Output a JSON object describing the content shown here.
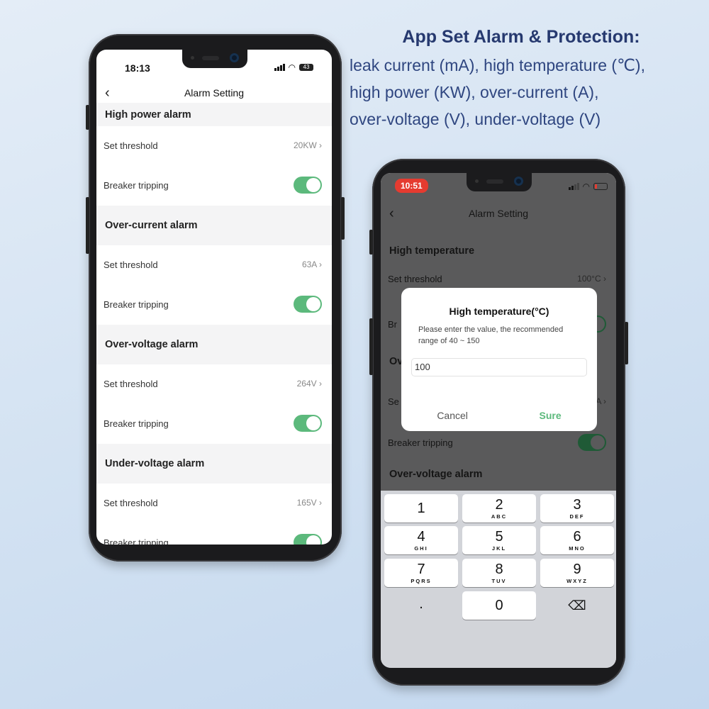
{
  "headline": {
    "title": "App Set Alarm & Protection:",
    "lines": [
      "leak current (mA), high temperature (℃),",
      "high power (KW), over-current (A),",
      "over-voltage (V), under-voltage (V)"
    ]
  },
  "phone1": {
    "time": "18:13",
    "battery": "43",
    "nav_title": "Alarm Setting",
    "sections": [
      {
        "title": "High power alarm",
        "threshold_label": "Set threshold",
        "threshold": "20KW",
        "trip_label": "Breaker tripping",
        "trip_on": true
      },
      {
        "title": "Over-current alarm",
        "threshold_label": "Set threshold",
        "threshold": "63A",
        "trip_label": "Breaker tripping",
        "trip_on": true
      },
      {
        "title": "Over-voltage alarm",
        "threshold_label": "Set threshold",
        "threshold": "264V",
        "trip_label": "Breaker tripping",
        "trip_on": true
      },
      {
        "title": "Under-voltage alarm",
        "threshold_label": "Set threshold",
        "threshold": "165V",
        "trip_label": "Breaker tripping",
        "trip_on": true
      }
    ]
  },
  "phone2": {
    "time": "10:51",
    "nav_title": "Alarm Setting",
    "bg": {
      "sec1": "High temperature",
      "set": "Set threshold",
      "val": "100°C",
      "trip": "Breaker tripping",
      "sec2": "Ov",
      "set2": "Se",
      "val2": "A",
      "trip2": "Breaker tripping",
      "sec3": "Over-voltage alarm"
    },
    "dialog": {
      "title": "High temperature(°C)",
      "message": "Please enter the value, the recommended range of 40 ~ 150",
      "value": "100",
      "cancel": "Cancel",
      "confirm": "Sure"
    },
    "keyboard": [
      {
        "d": "1",
        "l": ""
      },
      {
        "d": "2",
        "l": "ABC"
      },
      {
        "d": "3",
        "l": "DEF"
      },
      {
        "d": "4",
        "l": "GHI"
      },
      {
        "d": "5",
        "l": "JKL"
      },
      {
        "d": "6",
        "l": "MNO"
      },
      {
        "d": "7",
        "l": "PQRS"
      },
      {
        "d": "8",
        "l": "TUV"
      },
      {
        "d": "9",
        "l": "WXYZ"
      },
      {
        "d": ".",
        "l": ""
      },
      {
        "d": "0",
        "l": ""
      },
      {
        "d": "⌫",
        "l": ""
      }
    ]
  },
  "colors": {
    "accent": "#5cb97c",
    "heading": "#26396f",
    "time_pill": "#e53b30"
  }
}
